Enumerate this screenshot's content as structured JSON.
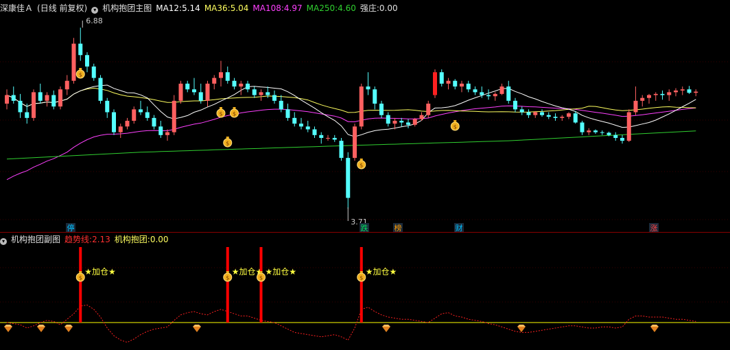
{
  "main_header": {
    "stock": "深康佳Ａ",
    "period": "(日线 前复权)",
    "indicator": "机构抱团主图",
    "ma12_label": "MA12:",
    "ma12": "5.14",
    "ma36_label": "MA36:",
    "ma36": "5.04",
    "ma108_label": "MA108:",
    "ma108": "4.97",
    "ma250_label": "MA250:",
    "ma250": "4.60",
    "qz_label": "强庄:",
    "qz": "0.00"
  },
  "sub_header": {
    "indicator": "机构抱团副图",
    "trend_label": "趋势线:",
    "trend": "2.13",
    "jg_label": "机构抱团:",
    "jg": "0.00"
  },
  "annotations": {
    "high": "6.88",
    "low": "3.71",
    "add_signal": "★加仓★"
  },
  "tags": [
    {
      "text": "停",
      "color": "#00c0ff"
    },
    {
      "text": "跌",
      "color": "#00e060"
    },
    {
      "text": "榜",
      "color": "#ff9a00"
    },
    {
      "text": "财",
      "color": "#00c0ff"
    },
    {
      "text": "涨",
      "color": "#ff4040"
    }
  ],
  "colors": {
    "up": "#ff6060",
    "down": "#54ffff",
    "limit_up": "#ff2020",
    "ma12": "#ffffff",
    "ma36": "#ffff60",
    "ma108": "#ff40ff",
    "ma250": "#30d030",
    "trend": "#ff2020",
    "baseline": "#ffff00",
    "signal": "#ff0000"
  },
  "chart_data": {
    "type": "candlestick",
    "price_range": [
      3.4,
      7.1
    ],
    "candles": [
      [
        5.55,
        5.8,
        5.45,
        5.7
      ],
      [
        5.7,
        5.85,
        5.55,
        5.6
      ],
      [
        5.6,
        5.72,
        5.3,
        5.4
      ],
      [
        5.4,
        5.55,
        5.2,
        5.3
      ],
      [
        5.3,
        5.8,
        5.25,
        5.75
      ],
      [
        5.75,
        5.9,
        5.55,
        5.6
      ],
      [
        5.6,
        5.75,
        5.5,
        5.7
      ],
      [
        5.7,
        5.78,
        5.45,
        5.5
      ],
      [
        5.5,
        5.85,
        5.45,
        5.8
      ],
      [
        5.8,
        6.05,
        5.7,
        5.95
      ],
      [
        5.95,
        6.7,
        5.9,
        6.6
      ],
      [
        6.6,
        6.88,
        6.3,
        6.4
      ],
      [
        6.4,
        6.45,
        6.1,
        6.2
      ],
      [
        6.2,
        6.25,
        5.95,
        6.0
      ],
      [
        6.0,
        6.05,
        5.55,
        5.6
      ],
      [
        5.6,
        5.65,
        5.3,
        5.4
      ],
      [
        5.4,
        5.45,
        5.0,
        5.05
      ],
      [
        5.05,
        5.2,
        4.95,
        5.15
      ],
      [
        5.15,
        5.3,
        5.1,
        5.25
      ],
      [
        5.25,
        5.5,
        5.2,
        5.45
      ],
      [
        5.45,
        5.6,
        5.35,
        5.4
      ],
      [
        5.4,
        5.5,
        5.25,
        5.3
      ],
      [
        5.3,
        5.35,
        5.1,
        5.15
      ],
      [
        5.15,
        5.25,
        4.95,
        5.0
      ],
      [
        5.0,
        5.1,
        4.9,
        5.05
      ],
      [
        5.05,
        5.7,
        5.0,
        5.6
      ],
      [
        5.6,
        5.95,
        5.55,
        5.9
      ],
      [
        5.9,
        5.95,
        5.75,
        5.8
      ],
      [
        5.8,
        6.0,
        5.7,
        5.75
      ],
      [
        5.75,
        5.9,
        5.55,
        5.6
      ],
      [
        5.6,
        5.95,
        5.5,
        5.9
      ],
      [
        5.9,
        6.05,
        5.8,
        6.0
      ],
      [
        6.0,
        6.3,
        5.85,
        6.1
      ],
      [
        6.1,
        6.2,
        5.9,
        5.95
      ],
      [
        5.95,
        6.0,
        5.8,
        5.85
      ],
      [
        5.85,
        5.95,
        5.7,
        5.9
      ],
      [
        5.9,
        5.95,
        5.75,
        5.8
      ],
      [
        5.8,
        5.85,
        5.65,
        5.7
      ],
      [
        5.7,
        5.8,
        5.6,
        5.75
      ],
      [
        5.75,
        5.85,
        5.65,
        5.7
      ],
      [
        5.7,
        5.78,
        5.55,
        5.6
      ],
      [
        5.6,
        5.7,
        5.4,
        5.45
      ],
      [
        5.45,
        5.55,
        5.25,
        5.3
      ],
      [
        5.3,
        5.4,
        5.15,
        5.2
      ],
      [
        5.2,
        5.3,
        5.1,
        5.15
      ],
      [
        5.15,
        5.25,
        5.05,
        5.1
      ],
      [
        5.1,
        5.15,
        4.95,
        5.0
      ],
      [
        5.0,
        5.05,
        4.85,
        4.95
      ],
      [
        4.95,
        5.0,
        4.9,
        4.95
      ],
      [
        4.95,
        5.0,
        4.88,
        4.92
      ],
      [
        4.9,
        4.95,
        4.55,
        4.6
      ],
      [
        4.6,
        4.7,
        3.71,
        3.9
      ],
      [
        4.6,
        5.2,
        4.55,
        5.15
      ],
      [
        5.15,
        5.9,
        5.1,
        5.85
      ],
      [
        5.85,
        6.1,
        5.7,
        5.8
      ],
      [
        5.8,
        5.85,
        5.45,
        5.55
      ],
      [
        5.55,
        5.6,
        5.3,
        5.35
      ],
      [
        5.35,
        5.4,
        5.15,
        5.2
      ],
      [
        5.2,
        5.3,
        5.1,
        5.25
      ],
      [
        5.25,
        5.3,
        5.15,
        5.22
      ],
      [
        5.22,
        5.28,
        5.12,
        5.18
      ],
      [
        5.18,
        5.3,
        5.15,
        5.28
      ],
      [
        5.28,
        5.4,
        5.25,
        5.35
      ],
      [
        5.35,
        5.6,
        5.3,
        5.55
      ],
      [
        5.7,
        6.15,
        5.65,
        6.1
      ],
      [
        6.1,
        6.15,
        5.85,
        5.9
      ],
      [
        5.9,
        6.0,
        5.8,
        5.95
      ],
      [
        5.95,
        5.98,
        5.8,
        5.85
      ],
      [
        5.85,
        5.95,
        5.75,
        5.9
      ],
      [
        5.9,
        5.95,
        5.75,
        5.8
      ],
      [
        5.8,
        5.85,
        5.7,
        5.75
      ],
      [
        5.75,
        5.85,
        5.65,
        5.7
      ],
      [
        5.7,
        5.8,
        5.62,
        5.68
      ],
      [
        5.68,
        5.75,
        5.6,
        5.72
      ],
      [
        5.72,
        5.9,
        5.7,
        5.85
      ],
      [
        5.85,
        5.95,
        5.55,
        5.6
      ],
      [
        5.6,
        5.65,
        5.4,
        5.45
      ],
      [
        5.45,
        5.5,
        5.35,
        5.4
      ],
      [
        5.4,
        5.45,
        5.3,
        5.35
      ],
      [
        5.35,
        5.42,
        5.3,
        5.4
      ],
      [
        5.4,
        5.45,
        5.32,
        5.35
      ],
      [
        5.35,
        5.4,
        5.28,
        5.32
      ],
      [
        5.32,
        5.38,
        5.25,
        5.3
      ],
      [
        5.3,
        5.35,
        5.25,
        5.32
      ],
      [
        5.32,
        5.4,
        5.28,
        5.38
      ],
      [
        5.38,
        5.42,
        5.2,
        5.22
      ],
      [
        5.22,
        5.25,
        5.0,
        5.05
      ],
      [
        5.05,
        5.12,
        5.0,
        5.08
      ],
      [
        5.08,
        5.1,
        5.02,
        5.05
      ],
      [
        5.05,
        5.08,
        5.0,
        5.04
      ],
      [
        5.04,
        5.06,
        4.98,
        5.0
      ],
      [
        5.0,
        5.05,
        4.9,
        4.95
      ],
      [
        4.95,
        5.0,
        4.85,
        4.9
      ],
      [
        4.9,
        5.45,
        4.88,
        5.4
      ],
      [
        5.4,
        5.85,
        5.35,
        5.6
      ],
      [
        5.6,
        5.7,
        5.5,
        5.65
      ],
      [
        5.65,
        5.72,
        5.55,
        5.7
      ],
      [
        5.7,
        5.75,
        5.6,
        5.72
      ],
      [
        5.72,
        5.78,
        5.62,
        5.7
      ],
      [
        5.7,
        5.8,
        5.6,
        5.75
      ],
      [
        5.75,
        5.82,
        5.68,
        5.78
      ],
      [
        5.78,
        5.85,
        5.7,
        5.8
      ],
      [
        5.8,
        5.86,
        5.72,
        5.74
      ],
      [
        5.74,
        5.8,
        5.68,
        5.76
      ]
    ],
    "ma250": [
      [
        0,
        4.58
      ],
      [
        20,
        4.7
      ],
      [
        52,
        4.82
      ],
      [
        75,
        4.9
      ],
      [
        104,
        5.08
      ]
    ],
    "signals": [
      11,
      33,
      38,
      53
    ],
    "trend_sub": [
      0.0,
      -0.1,
      -0.2,
      -0.5,
      -0.3,
      0.0,
      0.2,
      0.1,
      -0.2,
      0.3,
      0.8,
      1.5,
      1.6,
      1.2,
      0.5,
      -0.5,
      -1.2,
      -1.6,
      -1.8,
      -1.5,
      -1.1,
      -0.8,
      -0.6,
      -0.5,
      -0.4,
      0.2,
      0.7,
      0.9,
      1.0,
      0.8,
      0.7,
      1.0,
      1.2,
      1.0,
      0.8,
      0.6,
      0.6,
      0.4,
      0.2,
      0.1,
      0.0,
      -0.3,
      -0.6,
      -0.9,
      -1.0,
      -1.1,
      -1.2,
      -1.3,
      -1.2,
      -1.1,
      -1.3,
      -1.6,
      -0.5,
      1.2,
      1.4,
      1.0,
      0.7,
      0.5,
      0.4,
      0.3,
      0.3,
      0.2,
      0.1,
      0.0,
      0.4,
      0.8,
      0.9,
      0.6,
      0.5,
      0.3,
      0.2,
      0.1,
      -0.1,
      -0.2,
      -0.4,
      -0.6,
      -0.8,
      -0.9,
      -0.9,
      -0.8,
      -0.7,
      -0.6,
      -0.5,
      -0.4,
      -0.3,
      -0.3,
      -0.4,
      -0.5,
      -0.5,
      -0.4,
      -0.4,
      -0.5,
      -0.4,
      0.3,
      0.6,
      0.6,
      0.5,
      0.5,
      0.5,
      0.4,
      0.3,
      0.3,
      0.2,
      0.1
    ]
  }
}
